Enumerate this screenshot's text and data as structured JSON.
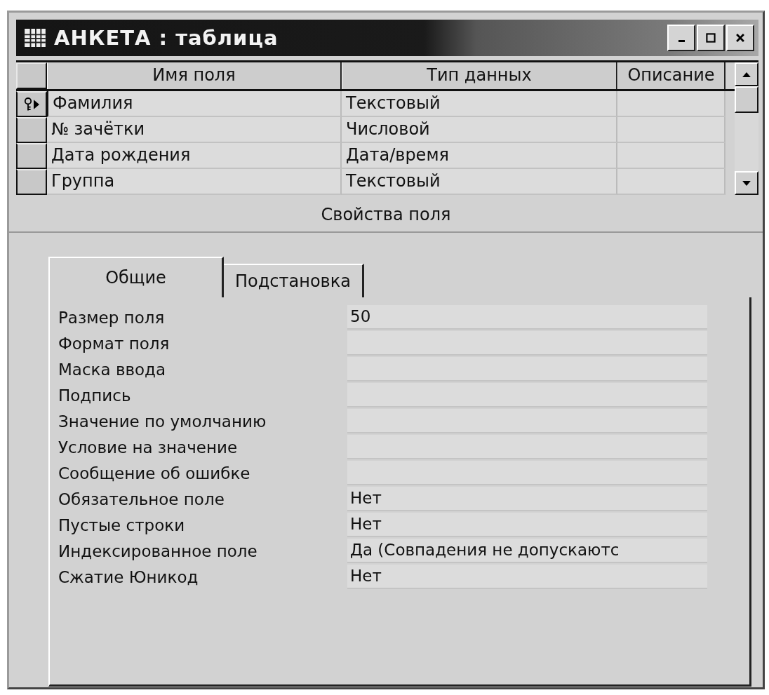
{
  "window": {
    "title": "АНКЕТА : таблица"
  },
  "grid": {
    "columns": [
      "Имя поля",
      "Тип данных",
      "Описание"
    ],
    "rows": [
      {
        "name": "Фамилия",
        "type": "Текстовый",
        "primary_key": true,
        "selected": true
      },
      {
        "name": "№ зачётки",
        "type": "Числовой",
        "primary_key": false,
        "selected": false
      },
      {
        "name": "Дата рождения",
        "type": "Дата/время",
        "primary_key": false,
        "selected": false
      },
      {
        "name": "Группа",
        "type": "Текстовый",
        "primary_key": false,
        "selected": false
      }
    ]
  },
  "properties_title": "Свойства поля",
  "tabs": [
    {
      "label": "Общие",
      "selected": true
    },
    {
      "label": "Подстановка",
      "selected": false
    }
  ],
  "properties": [
    {
      "label": "Размер поля",
      "value": "50"
    },
    {
      "label": "Формат поля"
    },
    {
      "label": "Маска ввода"
    },
    {
      "label": "Подпись"
    },
    {
      "label": "Значение по умолчанию"
    },
    {
      "label": "Условие на значение"
    },
    {
      "label": "Сообщение об ошибке"
    },
    {
      "label": "Обязательное поле",
      "value": "Нет"
    },
    {
      "label": "Пустые строки",
      "value": "Нет"
    },
    {
      "label": "Индексированное поле",
      "value": "Да (Совпадения не допускаютс"
    },
    {
      "label": "Сжатие Юникод",
      "value": "Нет"
    }
  ]
}
